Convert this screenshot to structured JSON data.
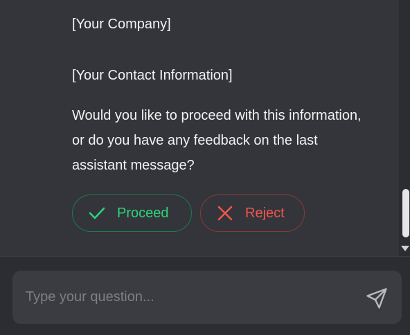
{
  "message": {
    "company_line": "[Your Company]",
    "contact_line": "[Your Contact Information]",
    "question": "Would you like to proceed with this information, or do you have any feedback on the last assistant message?"
  },
  "actions": {
    "proceed_label": "Proceed",
    "proceed_icon": "check-icon",
    "proceed_color": "#2ed47a",
    "reject_label": "Reject",
    "reject_icon": "x-icon",
    "reject_color": "#f2564a"
  },
  "input": {
    "value": "",
    "placeholder": "Type your question...",
    "send_icon": "send-icon"
  }
}
